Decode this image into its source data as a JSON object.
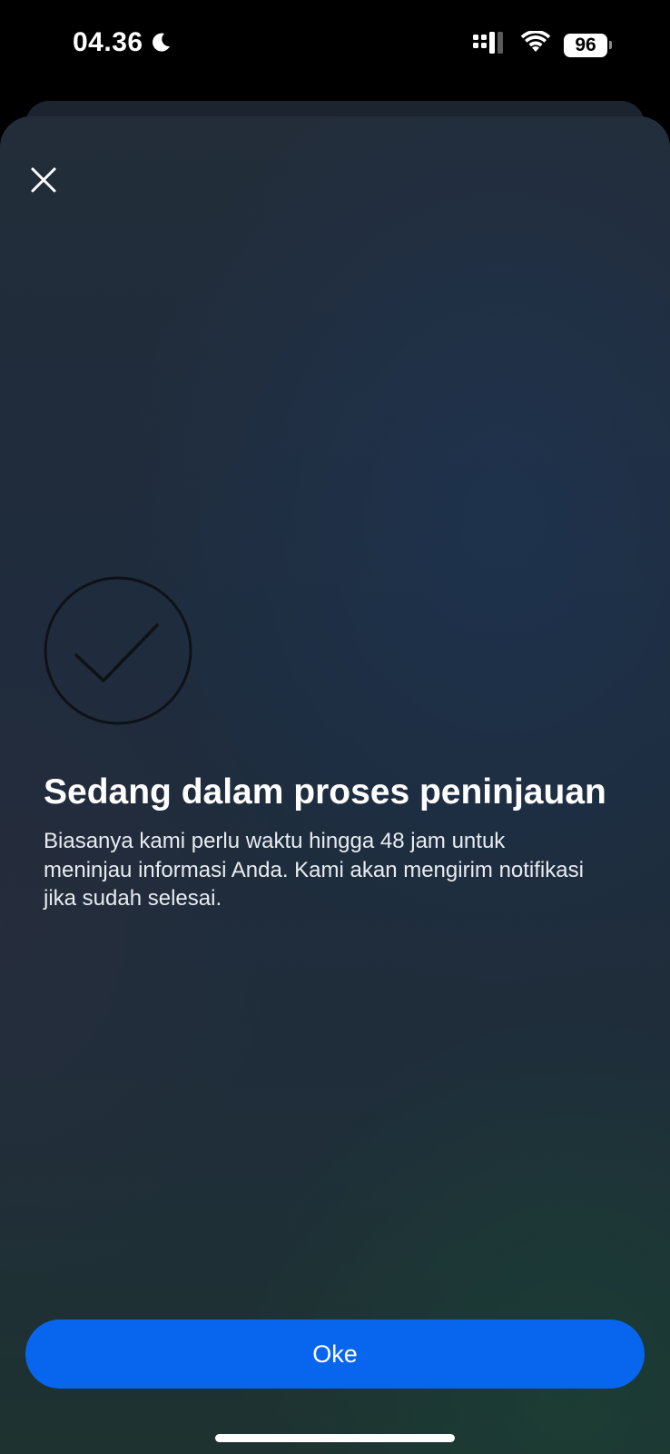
{
  "status_bar": {
    "time": "04.36",
    "moon_icon": "moon-icon",
    "signal_icon": "cellular-signal-icon",
    "wifi_icon": "wifi-icon",
    "battery_level": "96"
  },
  "sheet": {
    "close_icon": "close-icon",
    "status_icon": "check-circle-icon",
    "title": "Sedang dalam proses peninjauan",
    "description": "Biasanya kami perlu waktu hingga 48 jam untuk meninjau informasi Anda. Kami akan mengirim notifikasi jika sudah selesai.",
    "ok_label": "Oke"
  },
  "colors": {
    "primary_button": "#0866ee",
    "sheet_background": "#1f2d3b",
    "text_primary": "#ffffff"
  }
}
